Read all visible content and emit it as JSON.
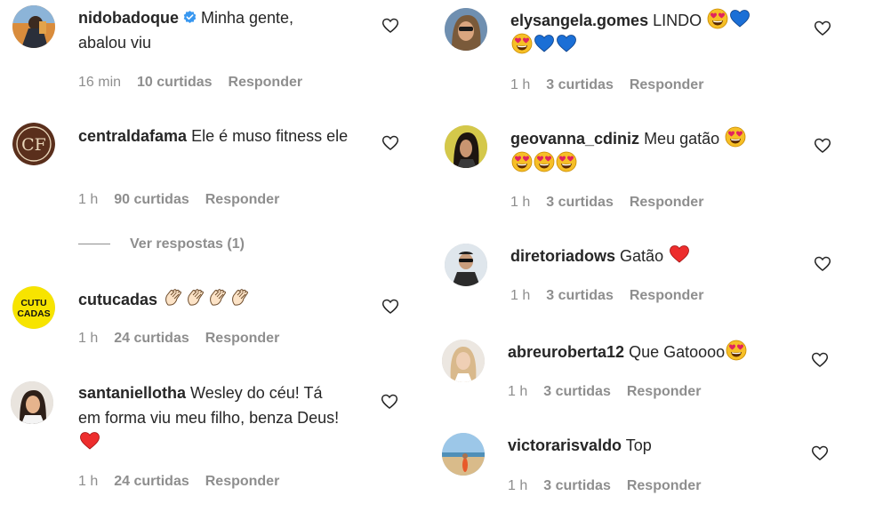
{
  "left": [
    {
      "user": "nidobadoque",
      "verified": true,
      "text": "Minha gente, abalou viu",
      "time": "16 min",
      "likes": "10 curtidas",
      "reply": "Responder",
      "emojis": []
    },
    {
      "user": "centraldafama",
      "verified": false,
      "text": "Ele é muso fitness ele",
      "time": "1 h",
      "likes": "90 curtidas",
      "reply": "Responder",
      "emojis": [],
      "avatar_text": "CF",
      "view_replies": "Ver respostas (1)"
    },
    {
      "user": "cutucadas",
      "verified": false,
      "text": "",
      "time": "1 h",
      "likes": "24 curtidas",
      "reply": "Responder",
      "emojis": [
        "clap",
        "clap",
        "clap",
        "clap"
      ],
      "avatar_text": "CUTU CADAS"
    },
    {
      "user": "santaniellotha",
      "verified": false,
      "text": "Wesley do céu! Tá em forma viu meu filho, benza Deus!",
      "time": "1 h",
      "likes": "24 curtidas",
      "reply": "Responder",
      "emojis": [
        "red-heart"
      ]
    }
  ],
  "right": [
    {
      "user": "elysangela.gomes",
      "verified": false,
      "text": "LINDO",
      "time": "1 h",
      "likes": "3 curtidas",
      "reply": "Responder",
      "emojis": [
        "heart-eyes",
        "blue-heart",
        "heart-eyes",
        "blue-heart",
        "blue-heart"
      ]
    },
    {
      "user": "geovanna_cdiniz",
      "verified": false,
      "text": "Meu gatão",
      "time": "1 h",
      "likes": "3 curtidas",
      "reply": "Responder",
      "emojis": [
        "heart-eyes",
        "heart-eyes",
        "heart-eyes",
        "heart-eyes"
      ]
    },
    {
      "user": "diretoriadows",
      "verified": false,
      "text": "Gatão",
      "time": "1 h",
      "likes": "3 curtidas",
      "reply": "Responder",
      "emojis": [
        "red-heart"
      ]
    },
    {
      "user": "abreuroberta12",
      "verified": false,
      "text": "Que Gatoooo",
      "time": "1 h",
      "likes": "3 curtidas",
      "reply": "Responder",
      "emojis": [
        "heart-eyes"
      ]
    },
    {
      "user": "victorarisvaldo",
      "verified": false,
      "text": "Top",
      "time": "1 h",
      "likes": "3 curtidas",
      "reply": "Responder",
      "emojis": []
    }
  ],
  "colors": {
    "meta": "#8e8e8e",
    "text": "#262626",
    "verified": "#3897f0",
    "heart_red": "#ed2d2d",
    "heart_blue": "#1b6fd6",
    "emoji_yellow": "#f6bf26"
  }
}
